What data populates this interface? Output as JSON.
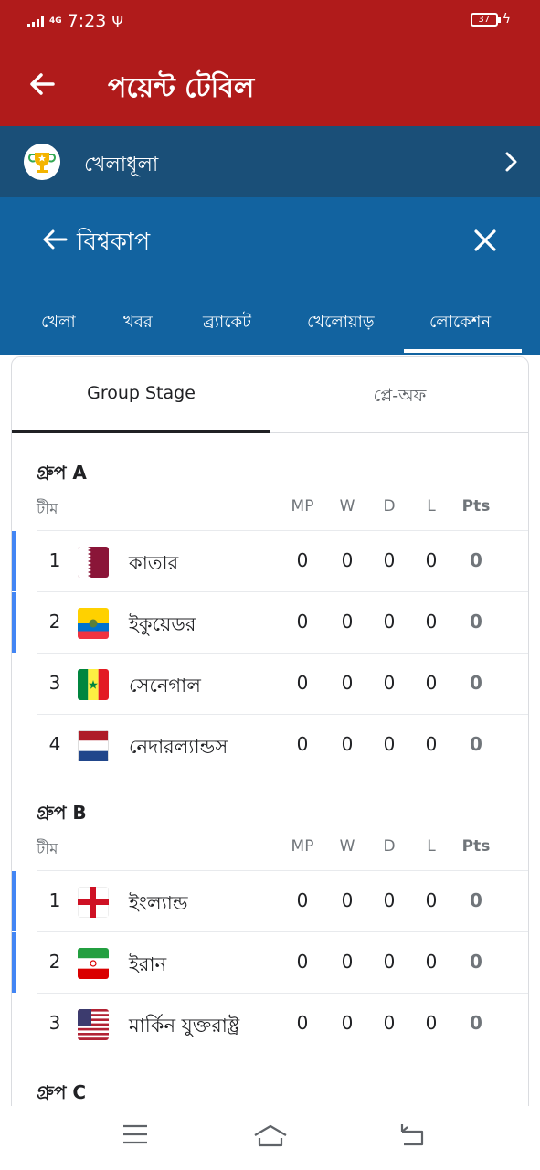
{
  "status_bar": {
    "network": "4G",
    "time": "7:23",
    "usb": "Ψ",
    "battery": "37",
    "charging": "ϟ"
  },
  "app_bar": {
    "title": "পয়েন্ট টেবিল"
  },
  "sports_row": {
    "label": "খেলাধূলা"
  },
  "worldcup": {
    "title": "বিশ্বকাপ",
    "tabs": [
      "খেলা",
      "খবর",
      "ব্র্যাকেট",
      "খেলোয়াড়",
      "লোকেশন"
    ],
    "active_tab": "লোকেশন"
  },
  "stage_tabs": {
    "group_stage": "Group Stage",
    "playoff": "প্লে-অফ",
    "active": "Group Stage"
  },
  "columns": {
    "team": "টীম",
    "mp": "MP",
    "w": "W",
    "d": "D",
    "l": "L",
    "pts": "Pts"
  },
  "groups": [
    {
      "title": "গ্রুপ A",
      "teams": [
        {
          "pos": "1",
          "name": "কাতার",
          "flag": "qatar-flag",
          "mp": "0",
          "w": "0",
          "d": "0",
          "l": "0",
          "pts": "0",
          "qualified": true
        },
        {
          "pos": "2",
          "name": "ইকুয়েডর",
          "flag": "ecuador-flag",
          "mp": "0",
          "w": "0",
          "d": "0",
          "l": "0",
          "pts": "0",
          "qualified": true
        },
        {
          "pos": "3",
          "name": "সেনেগাল",
          "flag": "senegal-flag",
          "mp": "0",
          "w": "0",
          "d": "0",
          "l": "0",
          "pts": "0",
          "qualified": false
        },
        {
          "pos": "4",
          "name": "নেদারল্যান্ডস",
          "flag": "netherlands-flag",
          "mp": "0",
          "w": "0",
          "d": "0",
          "l": "0",
          "pts": "0",
          "qualified": false
        }
      ]
    },
    {
      "title": "গ্রুপ B",
      "teams": [
        {
          "pos": "1",
          "name": "ইংল্যান্ড",
          "flag": "england-flag",
          "mp": "0",
          "w": "0",
          "d": "0",
          "l": "0",
          "pts": "0",
          "qualified": true
        },
        {
          "pos": "2",
          "name": "ইরান",
          "flag": "iran-flag",
          "mp": "0",
          "w": "0",
          "d": "0",
          "l": "0",
          "pts": "0",
          "qualified": true
        },
        {
          "pos": "3",
          "name": "মার্কিন যুক্তরাষ্ট্র",
          "flag": "usa-flag",
          "mp": "0",
          "w": "0",
          "d": "0",
          "l": "0",
          "pts": "0",
          "qualified": false
        }
      ]
    },
    {
      "title": "গ্রুপ C",
      "teams": []
    }
  ],
  "colors": {
    "app_bar": "#b01b1b",
    "sports_row": "#1a4f78",
    "worldcup_panel": "#1263a0",
    "qualify_bar": "#4285f4"
  },
  "system_nav": [
    "menu-icon",
    "home-icon",
    "back-icon"
  ]
}
